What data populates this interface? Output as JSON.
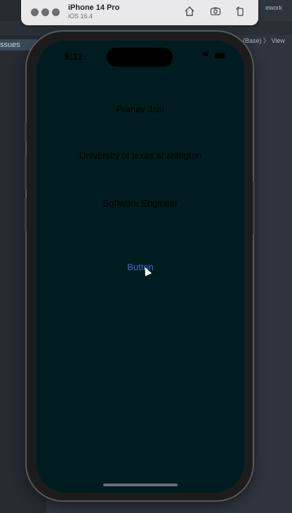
{
  "xcode": {
    "issues_label": "ssues",
    "top_right_text": "ework",
    "crumbs": "(Base) 〉 View"
  },
  "simulator": {
    "device_name": "iPhone 14 Pro",
    "os_version": "iOS 16.4",
    "buttons": [
      "home-icon",
      "screenshot-icon",
      "rotate-icon"
    ]
  },
  "phone": {
    "time": "8:12",
    "name_label": "Pranav Jain",
    "university_label": "University of texas at arlington",
    "role_label": "Software Engineer",
    "button_label": "Button",
    "colors": {
      "screen_bg": "#001c1e",
      "button_text": "#2f6fd6",
      "label_text": "#000000"
    }
  }
}
